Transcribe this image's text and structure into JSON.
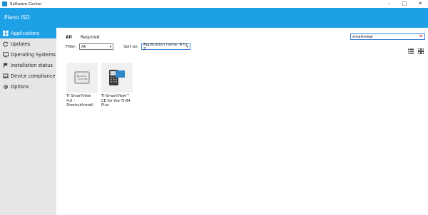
{
  "window": {
    "title": "Software Center"
  },
  "banner": {
    "org": "Plano ISD"
  },
  "sidebar": {
    "items": [
      {
        "label": "Applications",
        "icon": "apps-grid-icon",
        "active": true
      },
      {
        "label": "Updates",
        "icon": "refresh-icon",
        "active": false
      },
      {
        "label": "Operating Systems",
        "icon": "monitor-icon",
        "active": false
      },
      {
        "label": "Installation status",
        "icon": "flag-icon",
        "active": false
      },
      {
        "label": "Device compliance",
        "icon": "laptop-icon",
        "active": false
      },
      {
        "label": "Options",
        "icon": "gear-icon",
        "active": false
      }
    ]
  },
  "tabs": [
    {
      "label": "All",
      "active": true
    },
    {
      "label": "Required",
      "active": false
    }
  ],
  "search": {
    "value": "smartview"
  },
  "filter": {
    "label": "Filter:",
    "value": "All"
  },
  "sort": {
    "label": "Sort by:",
    "value": "Application name: A to Z"
  },
  "apps": [
    {
      "name": "TI SmartView 4.0 - ShortcutInstall",
      "icon": "app-placeholder-icon"
    },
    {
      "name": "TI-SmartView™ CE for the TI-84 Plus",
      "icon": "ti84-calculator-icon"
    }
  ],
  "colors": {
    "accent": "#1ea0e7",
    "sidebar_bg": "#e6e6e6"
  }
}
